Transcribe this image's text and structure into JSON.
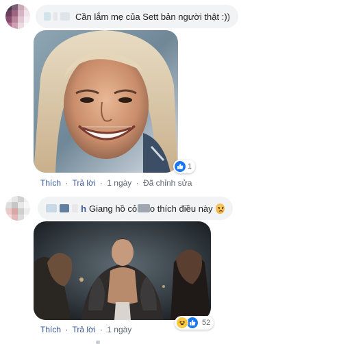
{
  "comment1": {
    "text": "Cần lắm mẹ của Sett bản người thật :))",
    "reaction_count": "1",
    "actions": {
      "like": "Thích",
      "reply": "Trả lời",
      "time": "1 ngày",
      "edited": "Đã chỉnh sửa"
    }
  },
  "comment2": {
    "author_visible": "h",
    "text_a": "Giang hồ cỏ",
    "text_b": "o thích điều này",
    "emoji": "angry-face-emoji",
    "reaction_count": "52",
    "actions": {
      "like": "Thích",
      "reply": "Trả lời",
      "time": "1 ngày"
    }
  },
  "colors": {
    "bubble": "#f2f3f5",
    "link": "#385898",
    "meta": "#606770",
    "like_blue": "#1877f2",
    "haha_yellow": "#f7c840"
  },
  "icons": [
    "like-icon",
    "haha-icon",
    "angry-emoji-icon"
  ]
}
